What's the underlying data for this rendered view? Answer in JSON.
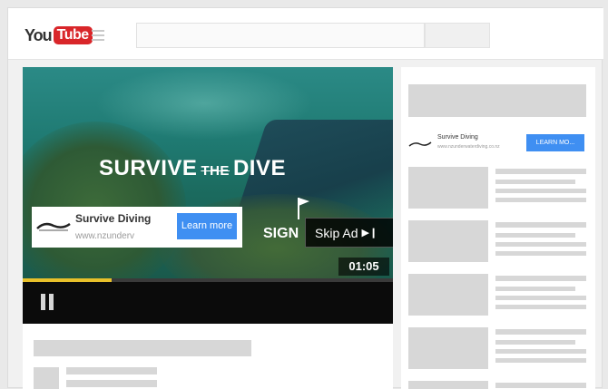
{
  "header": {
    "logo": {
      "you": "You",
      "tube": "Tube"
    },
    "search_placeholder": ""
  },
  "player": {
    "ad_title": {
      "word1": "SURVIVE",
      "word2": "THE",
      "word3": "DIVE"
    },
    "sign_text": "SIGN",
    "ad_overlay": {
      "name": "Survive Diving",
      "url": "www.nzunderv",
      "learn_more": "Learn more"
    },
    "skip_label": "Skip Ad",
    "skip_icon": "skip-next-icon",
    "timer": "01:05",
    "progress": 0.24
  },
  "sidebar": {
    "sponsored": {
      "name": "Survive Diving",
      "url": "www.nzunderwaterdiving.co.nz",
      "button": "LEARN MO..."
    }
  },
  "colors": {
    "youtube_red": "#d9262a",
    "accent_blue": "#3f8ff2",
    "progress_yellow": "#e8c02a"
  }
}
